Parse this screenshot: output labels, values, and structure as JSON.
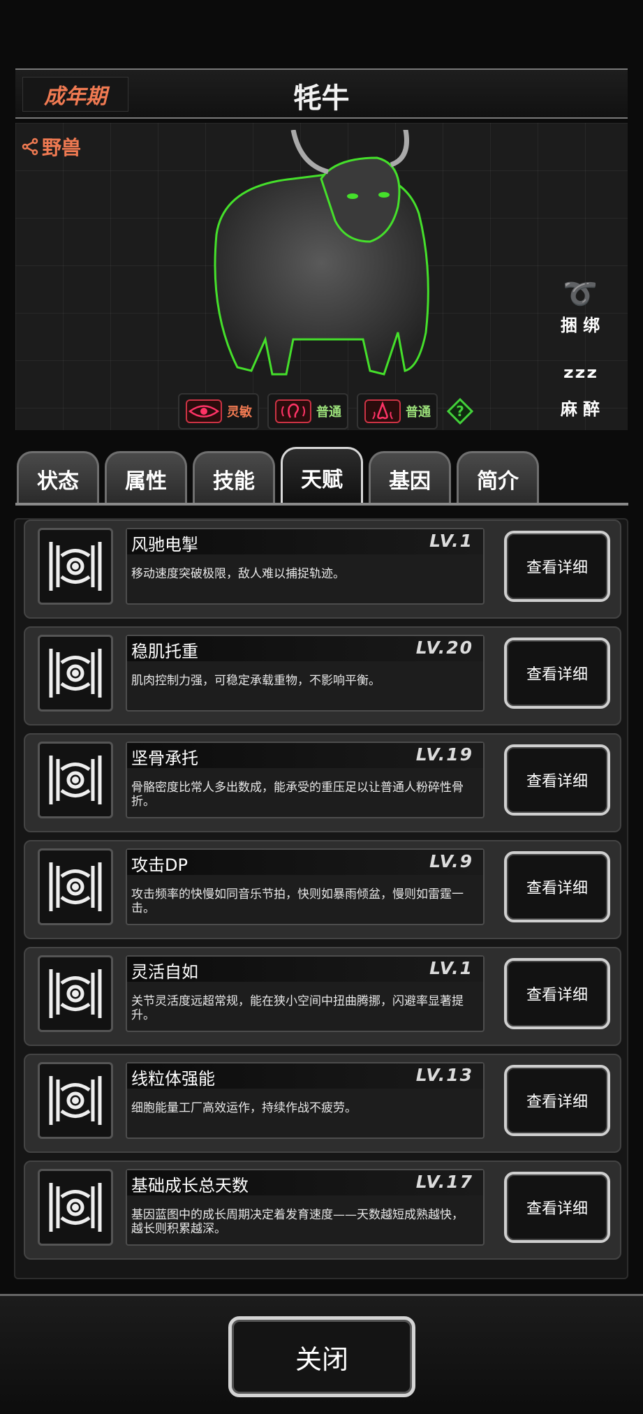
{
  "header": {
    "stage": "成年期",
    "title": "牦牛"
  },
  "creature": {
    "type_tag": "野兽",
    "image_icon": "yak-illustration",
    "actions": [
      {
        "label": "捆 绑",
        "icon": "rope-icon"
      },
      {
        "label": "麻 醉",
        "icon": "sleep-zzz-icon"
      }
    ],
    "senses": [
      {
        "label": "灵敏",
        "icon": "eye-icon",
        "color": "#f07a52"
      },
      {
        "label": "普通",
        "icon": "ear-icon",
        "color": "#9be07a"
      },
      {
        "label": "普通",
        "icon": "nose-icon",
        "color": "#9be07a"
      }
    ],
    "help_icon": "question-diamond-icon"
  },
  "tabs": [
    {
      "label": "状态",
      "active": false
    },
    {
      "label": "属性",
      "active": false
    },
    {
      "label": "技能",
      "active": false
    },
    {
      "label": "天赋",
      "active": true
    },
    {
      "label": "基因",
      "active": false
    },
    {
      "label": "简介",
      "active": false
    }
  ],
  "talents": [
    {
      "name": "风驰电掣",
      "level": "LV.1",
      "desc": "移动速度突破极限，敌人难以捕捉轨迹。",
      "button": "查看详细"
    },
    {
      "name": "稳肌托重",
      "level": "LV.20",
      "desc": "肌肉控制力强，可稳定承载重物，不影响平衡。",
      "button": "查看详细"
    },
    {
      "name": "坚骨承托",
      "level": "LV.19",
      "desc": "骨骼密度比常人多出数成，能承受的重压足以让普通人粉碎性骨折。",
      "button": "查看详细"
    },
    {
      "name": "攻击DP",
      "level": "LV.9",
      "desc": "攻击频率的快慢如同音乐节拍，快则如暴雨倾盆，慢则如雷霆一击。",
      "button": "查看详细"
    },
    {
      "name": "灵活自如",
      "level": "LV.1",
      "desc": "关节灵活度远超常规，能在狭小空间中扭曲腾挪，闪避率显著提升。",
      "button": "查看详细"
    },
    {
      "name": "线粒体强能",
      "level": "LV.13",
      "desc": "细胞能量工厂高效运作，持续作战不疲劳。",
      "button": "查看详细"
    },
    {
      "name": "基础成长总天数",
      "level": "LV.17",
      "desc": "基因蓝图中的成长周期决定着发育速度——天数越短成熟越快，越长则积累越深。",
      "button": "查看详细"
    }
  ],
  "close_button": "关闭"
}
